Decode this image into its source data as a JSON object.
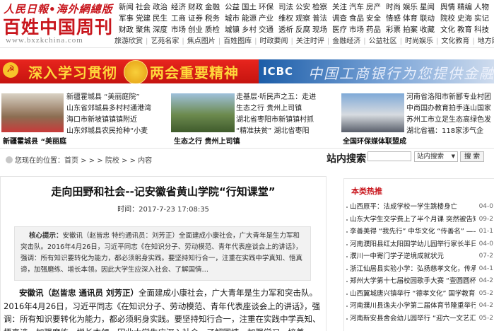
{
  "logo": {
    "rmrb": "人民日報•海外網總版",
    "title": "百姓中国周刊",
    "url": "www.bxzkchina.com"
  },
  "topnav": [
    {
      "rows": [
        [
          "新闻",
          "社会",
          "政治"
        ],
        [
          "军事",
          "党建",
          "民生"
        ],
        [
          "财政",
          "聚焦",
          "深度"
        ]
      ]
    },
    {
      "rows": [
        [
          "经济",
          "财政",
          "金融"
        ],
        [
          "工商",
          "证券",
          "税务"
        ],
        [
          "市场",
          "创业",
          "质检"
        ]
      ]
    },
    {
      "rows": [
        [
          "公益",
          "国土",
          "环保"
        ],
        [
          "城市",
          "能源",
          "产业"
        ],
        [
          "城镇",
          "乡村",
          "交通"
        ]
      ]
    },
    {
      "rows": [
        [
          "司法",
          "公安",
          "检察"
        ],
        [
          "维权",
          "观察",
          "普法"
        ],
        [
          "透析",
          "反腐",
          "现场"
        ]
      ]
    },
    {
      "rows": [
        [
          "关注",
          "汽车",
          "房产"
        ],
        [
          "调查",
          "食品",
          "安全"
        ],
        [
          "医疗",
          "市场",
          "药品"
        ]
      ]
    },
    {
      "rows": [
        [
          "时尚",
          "娱乐",
          "星闻"
        ],
        [
          "情感",
          "体育",
          "联动"
        ],
        [
          "彩票",
          "拍案",
          "收藏"
        ]
      ]
    },
    {
      "rows": [
        [
          "舆情",
          "精编",
          "人物"
        ],
        [
          "院校",
          "史海",
          "实记"
        ],
        [
          "文化",
          "教育",
          "科技"
        ]
      ]
    }
  ],
  "channel": [
    "旅游欣赏",
    "艺苑名家",
    "焦点图片",
    "百姓图库",
    "时政要闻",
    "关注时评",
    "金融经济",
    "公益社区",
    "时尚娱乐",
    "文化教育",
    "地方网联"
  ],
  "banners": {
    "left_1": "深入学习贯彻",
    "left_2": "两会重要精神",
    "right_brand": "ICBC",
    "right_text": "中国工商银行为您提供金融服务"
  },
  "news": {
    "photos": [
      {
        "caption": "新疆霍城县 “美丽庭"
      },
      {
        "caption": "生态之行 贵州上司镇"
      },
      {
        "caption": "全国环保媒体联盟成"
      }
    ],
    "list_1": [
      "新疆霍城县 “美丽庭院”",
      "山东省郊城县多村村通港湾",
      "海口市新坡镇镇镇附近",
      "山东郊城县农民抢种“小麦"
    ],
    "list_2": [
      "走基层·听民声之五：走进",
      "生态之行 贵州上司镇",
      "湖北省枣阳市新镇镇村抓",
      "“精准扶贫” 湖北省枣阳"
    ],
    "list_3": [
      "河南省洛阳市新郾专业村团",
      "中尚国办教育拍手连山国家",
      "苏州工市立足生态高绿色发",
      "湖北省福：118家涉气企"
    ]
  },
  "breadcrumb": {
    "label": "您现在的位置：首页 > > > 院校 > > 内容"
  },
  "search": {
    "label": "站内搜索",
    "placeholder": "",
    "select": "站内搜索",
    "button": "搜 索"
  },
  "article": {
    "title": "走向田野和社会--记安徽省黄山学院“行知课堂”",
    "time": "时间：2017-7-23 17:08:35",
    "summary_label": "核心提示：",
    "summary_text": "安徽讯（赵皆忠 特约通讯员：刘芳正）全面建成小康社会，广大青年是生力军和突击队。2016年4月26日，习近平同志《在知识分子、劳动模范、青年代表座谈会上的讲话》，强调：所有知识要转化为能力，都必须躬身实践。要坚持知行合一，注重在实践中学真知、悟真谛，加强磨练、增长本领。因此大学生应深入社会、了解国情…",
    "body_lead": "安徽讯（赵皆忠 通讯员 刘芳正）",
    "body_text": "全面建成小康社会，广大青年是生力军和突击队。2016年4月26日，习近平同志《在知识分子、劳动模范、青年代表座谈会上的讲话》，强调：所有知识要转化为能力，都必须躬身实践。要坚持知行合一，注重在实践中学真知、悟真谛，加强磨练、增长本领。因此大学生应深入社会、了解国情，加强学习，培养"
  },
  "hot": {
    "title": "本类热推",
    "items": [
      {
        "t": "山西原平：法成学校一学生跳楼身亡",
        "d": "04-0"
      },
      {
        "t": "山东大学生交学费上了半个月课 突然被告知大学",
        "d": "09-2"
      },
      {
        "t": "李善美得 “我先行” 中华文化 “传善名” —— 云",
        "d": "01-1"
      },
      {
        "t": "河南濮阳县红太阳国学幼儿园举行家长半日开放",
        "d": "04-0"
      },
      {
        "t": "濮川一中寄门学子逆境成就状元",
        "d": "07-2"
      },
      {
        "t": "浙江仙居县实验小学：弘扬慈孝文化，传承中华",
        "d": "04-1"
      },
      {
        "t": "郑州大学第十七届校园歌手大赛 “壹圆圆杯”郑音",
        "d": "04-2"
      },
      {
        "t": "山西翼城唐兴镇举行 “德孝文化” 国学教育基地",
        "d": "05-2"
      },
      {
        "t": "河南濮川县逸夫小学第二届体育节隆重举行",
        "d": "04-2"
      },
      {
        "t": "河南新安县舍会幼儿园举行 “迎六一文艺汇” 演",
        "d": "05-2"
      }
    ]
  }
}
